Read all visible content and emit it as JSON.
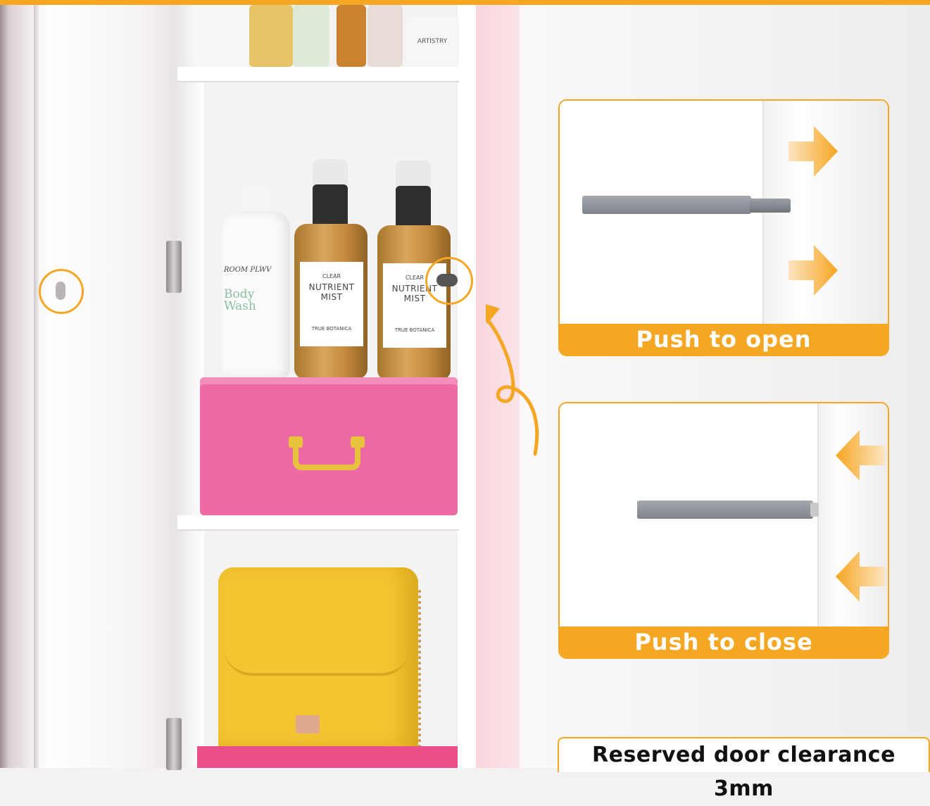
{
  "panels": {
    "open": {
      "caption": "Push to open"
    },
    "close": {
      "caption": "Push to close"
    }
  },
  "clearance": {
    "text": "Reserved door clearance 3mm"
  },
  "products": {
    "lotion_brand": "ROOM PLWV",
    "lotion_name": "Body Wash",
    "mist_label_top": "CLEAR",
    "mist_label_name": "NUTRIENT MIST",
    "mist_label_brand": "TRUE BOTANICA",
    "top_box": "ARTISTRY"
  },
  "colors": {
    "accent": "#f5a623",
    "pink_box": "#ee6aa4",
    "bag": "#f3c531"
  }
}
